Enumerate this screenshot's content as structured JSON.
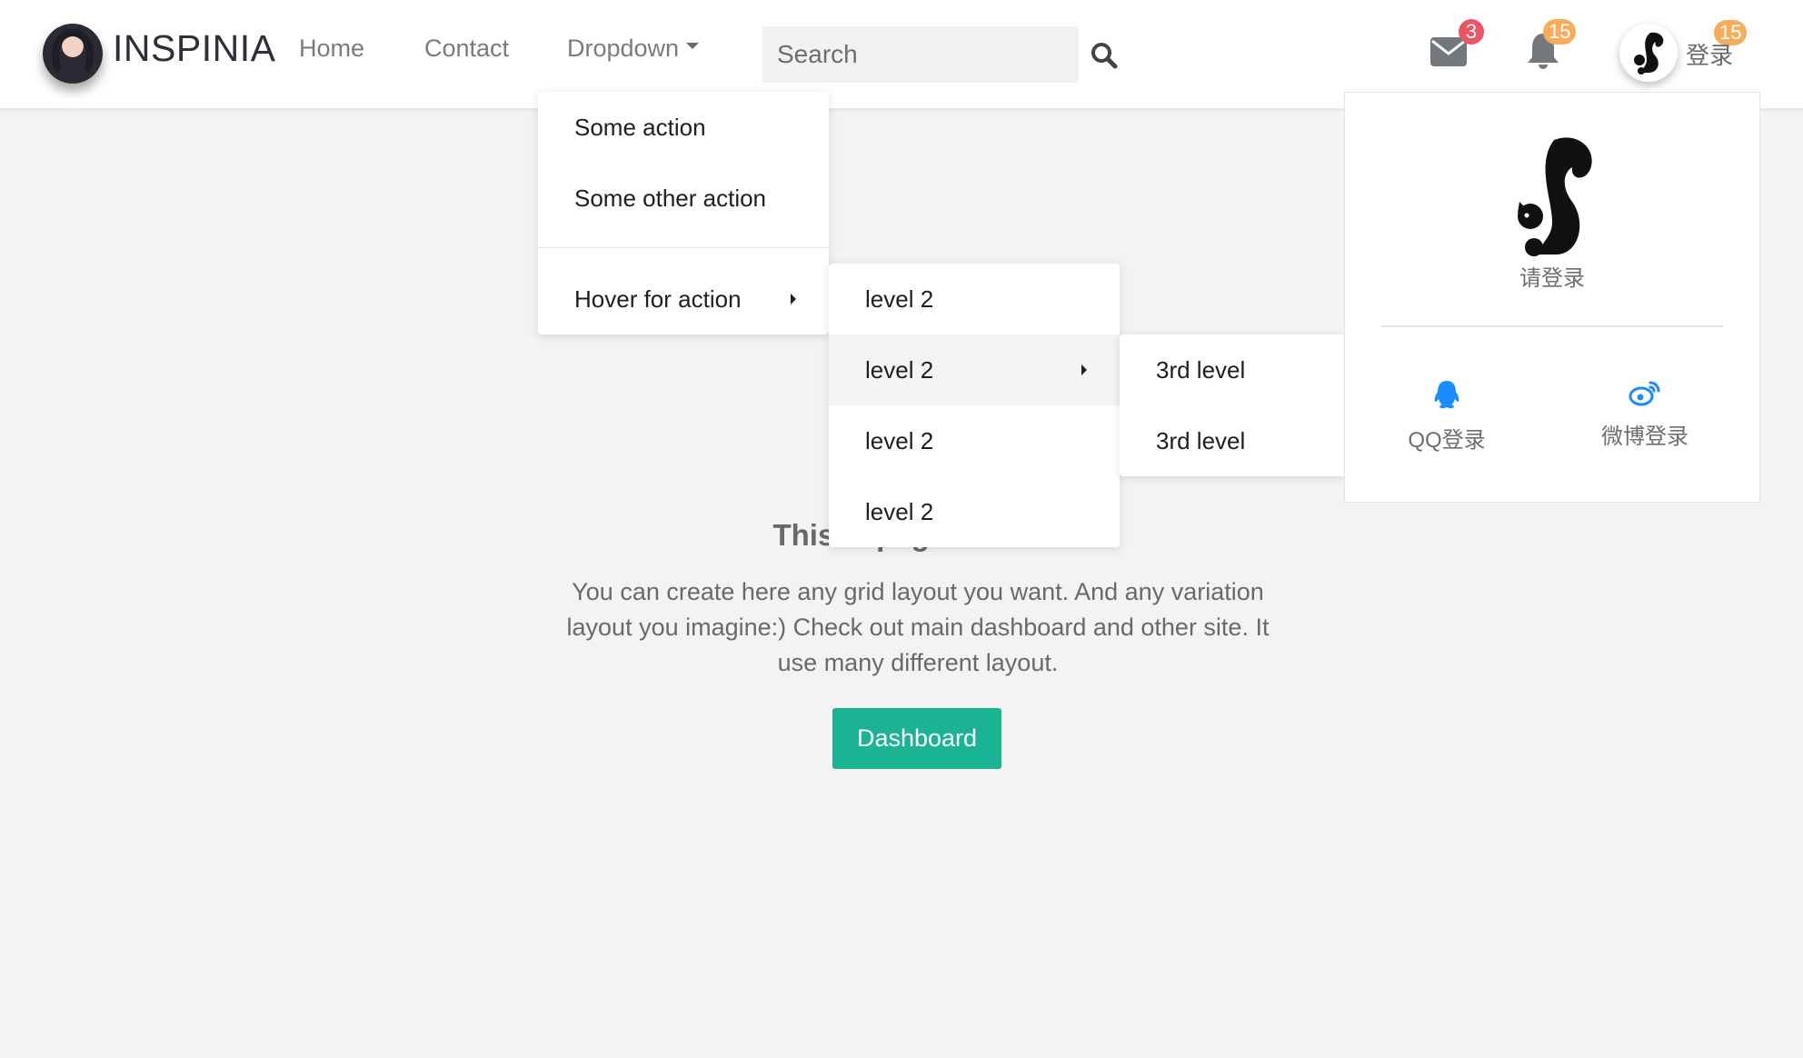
{
  "brand": {
    "name": "INSPINIA"
  },
  "nav": {
    "links": [
      {
        "label": "Home"
      },
      {
        "label": "Contact"
      },
      {
        "label": "Dropdown"
      }
    ]
  },
  "search": {
    "placeholder": "Search",
    "value": ""
  },
  "badges": {
    "mail": "3",
    "notifications": "15",
    "user": "15"
  },
  "user": {
    "login_label": "登录"
  },
  "dropdown": {
    "level1": [
      "Some action",
      "Some other action",
      "Hover for action"
    ],
    "level2": [
      "level 2",
      "level 2",
      "level 2",
      "level 2"
    ],
    "level3": [
      "3rd level",
      "3rd level"
    ]
  },
  "login_panel": {
    "prompt": "请登录",
    "qq_label": "QQ登录",
    "weibo_label": "微博登录"
  },
  "content": {
    "title": "This is page content",
    "text": "You can create here any grid layout you want. And any variation layout you imagine:) Check out main dashboard and other site. It use many different layout.",
    "button": "Dashboard"
  },
  "colors": {
    "accent": "#1ab394",
    "badge_red": "#ed5565",
    "badge_orange": "#f8ac59",
    "social_blue": "#1a8cff"
  }
}
